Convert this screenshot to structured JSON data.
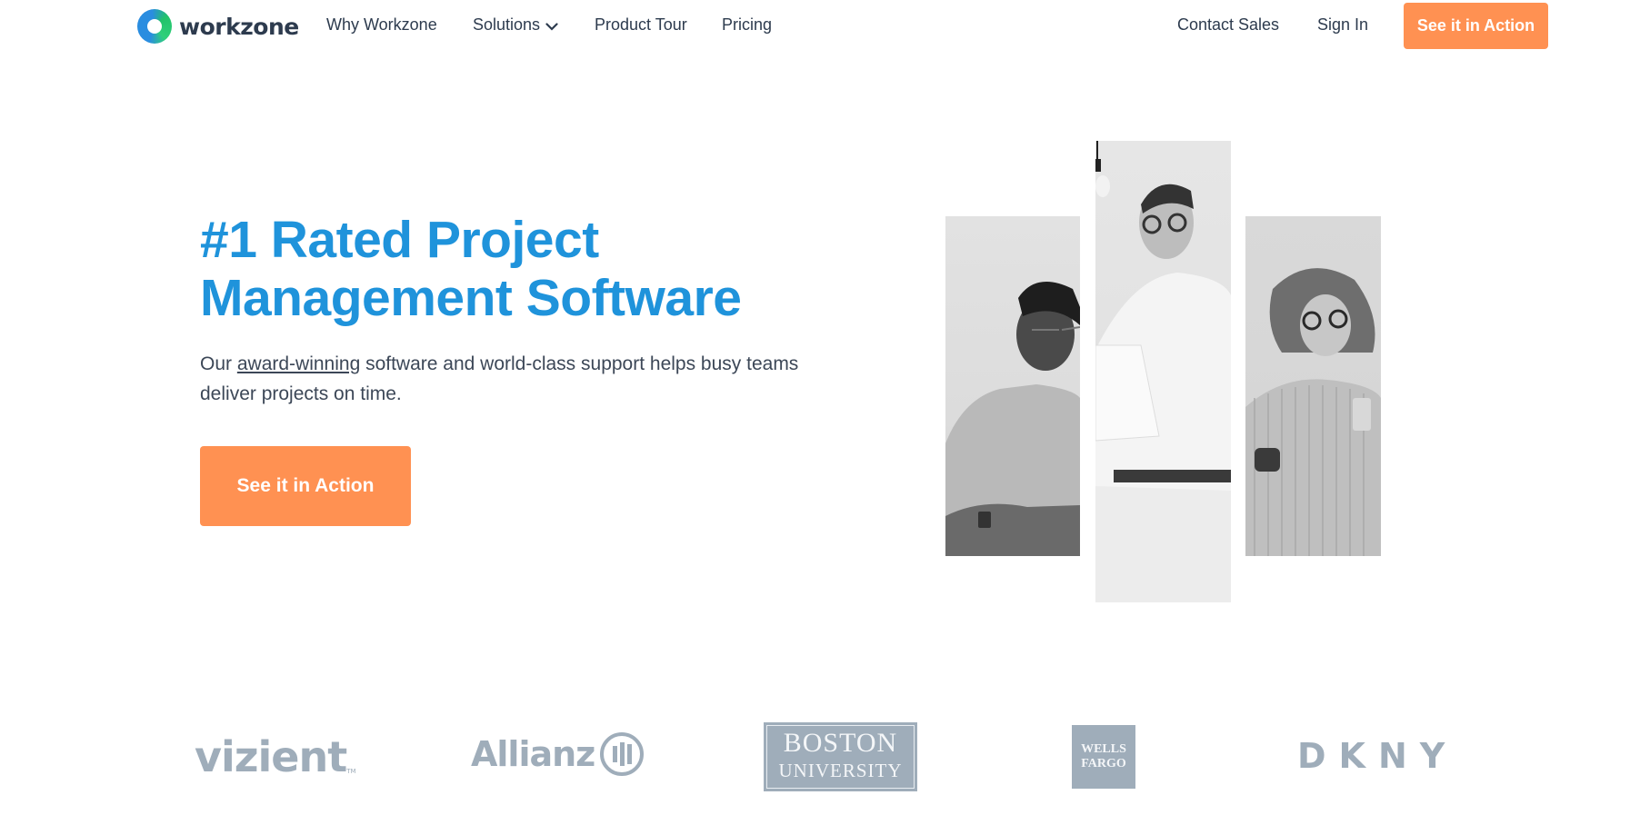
{
  "nav": {
    "logo_text": "workzone",
    "links": [
      {
        "label": "Why Workzone"
      },
      {
        "label": "Solutions",
        "has_dropdown": true
      },
      {
        "label": "Product Tour"
      },
      {
        "label": "Pricing"
      }
    ],
    "right_links": [
      {
        "label": "Contact Sales"
      },
      {
        "label": "Sign In"
      }
    ],
    "cta_label": "See it in Action"
  },
  "hero": {
    "title_bold": "#1 Rated",
    "title_rest_line1": " Project",
    "title_line2": "Management Software",
    "desc_prefix": "Our ",
    "desc_link": "award-winning",
    "desc_suffix": " software and world-class support helps busy teams deliver projects on time.",
    "cta_label": "See it in Action"
  },
  "photos": [
    {
      "alt": "Smiling man with glasses working at laptop"
    },
    {
      "alt": "Man in white shirt holding laptop"
    },
    {
      "alt": "Woman with glasses holding cup and phone"
    }
  ],
  "logos": {
    "vizient": "vizient",
    "vizient_tm": "TM",
    "allianz": "Allianz",
    "boston_line1": "BOSTON",
    "boston_line2": "UNIVERSITY",
    "wells_line1": "WELLS",
    "wells_line2": "FARGO",
    "dkny": "DKNY"
  },
  "colors": {
    "accent_blue": "#1f93db",
    "cta_orange": "#ff9152",
    "logo_gray": "#9fadba"
  }
}
